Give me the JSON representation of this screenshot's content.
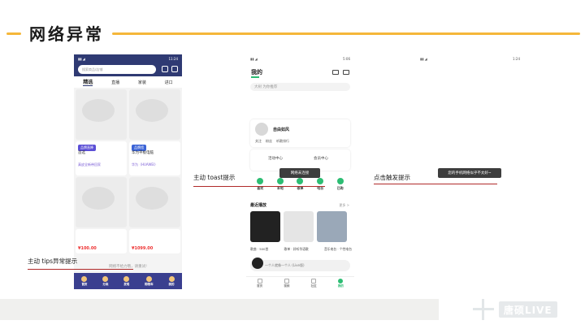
{
  "title": "网络异常",
  "labels": {
    "tips": "主动 tips异常提示",
    "toast": "主动 toast提示",
    "click": "点击触发提示"
  },
  "brand": "唐硕LIVE",
  "colors": {
    "accent": "#f5b73a",
    "underline": "#b02a2a",
    "green": "#2dbd73",
    "navy": "#2f3a73"
  },
  "phone1": {
    "status_time": "11:24",
    "search_placeholder": "搜索商品/店铺",
    "tabs": [
      "精选",
      "直播",
      "家装",
      "进口"
    ],
    "card_tag_1": "品牌直降",
    "card_title_1": "首选",
    "card_sub_1": "真皮全新带回家",
    "card_tag_2": "品牌馆",
    "card_title_2": "华为平板电脑",
    "card_sub_2": "华为（HUAWEI）",
    "price_1": "¥100.00",
    "price_2": "¥1099.00",
    "tip": "网络不给力哦，请重试!",
    "nav": [
      "首页",
      "分类",
      "发现",
      "购物车",
      "我的"
    ]
  },
  "phone2": {
    "status_time": "5:06",
    "header": "我的",
    "search_placeholder": "大树 为你推荐",
    "username": "自由如风",
    "stats": [
      "关注",
      "粉丝",
      "听歌排行"
    ],
    "service_1": "活动中心",
    "service_2": "会员中心",
    "toast": "网络未连接",
    "quick": [
      "喜欢",
      "本地",
      "歌单",
      "电台",
      "已购"
    ],
    "recent_title": "最近播放",
    "more": "更多 >",
    "recent_labels": [
      "歌曲 · 500首",
      "歌单 · 好听华语歌",
      "音乐电台 · 个性电台"
    ],
    "player_text": "一个人就像一个人 (Live版)",
    "nav": [
      "首页",
      "视频",
      "社区",
      "我的"
    ]
  },
  "phone3": {
    "status_time": "1:24",
    "toast": "您的手机网络似乎不太好~"
  }
}
